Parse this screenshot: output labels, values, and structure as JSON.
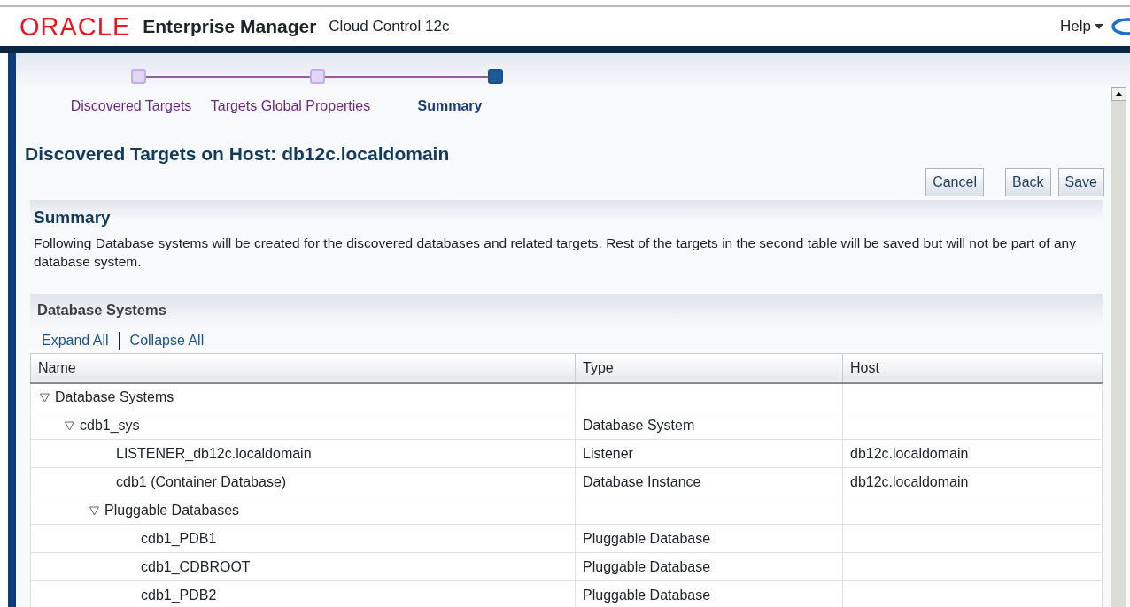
{
  "header": {
    "brand": "ORACLE",
    "product": "Enterprise Manager",
    "edition": "Cloud Control 12c",
    "help": "Help"
  },
  "train": [
    {
      "label": "Discovered Targets",
      "selected": false
    },
    {
      "label": "Targets Global Properties",
      "selected": false
    },
    {
      "label": "Summary",
      "selected": true
    }
  ],
  "page_title": "Discovered Targets on Host: db12c.localdomain",
  "buttons": [
    "Cancel",
    "Back",
    "Save"
  ],
  "summary": {
    "title": "Summary",
    "text": "Following Database systems will be created for the discovered databases and related targets. Rest of the targets in the second table will be saved but will not be part of any database system."
  },
  "database_systems": {
    "title": "Database Systems",
    "links": [
      "Expand All",
      "Collapse All"
    ],
    "columns": [
      "Name",
      "Type",
      "Host"
    ],
    "rows": [
      {
        "name": "Database Systems",
        "expanded": true,
        "children": [
          {
            "name": "cdb1_sys",
            "type": "Database System",
            "expanded": true,
            "children": [
              {
                "name": "LISTENER_db12c.localdomain",
                "type": "Listener",
                "host": "db12c.localdomain"
              },
              {
                "name": "cdb1 (Container Database)",
                "type": "Database Instance",
                "host": "db12c.localdomain"
              },
              {
                "name": "Pluggable Databases",
                "expanded": true,
                "children": [
                  {
                    "name": "cdb1_PDB1",
                    "type": "Pluggable Database"
                  },
                  {
                    "name": "cdb1_CDBROOT",
                    "type": "Pluggable Database"
                  },
                  {
                    "name": "cdb1_PDB2",
                    "type": "Pluggable Database"
                  }
                ]
              }
            ]
          }
        ]
      }
    ]
  }
}
